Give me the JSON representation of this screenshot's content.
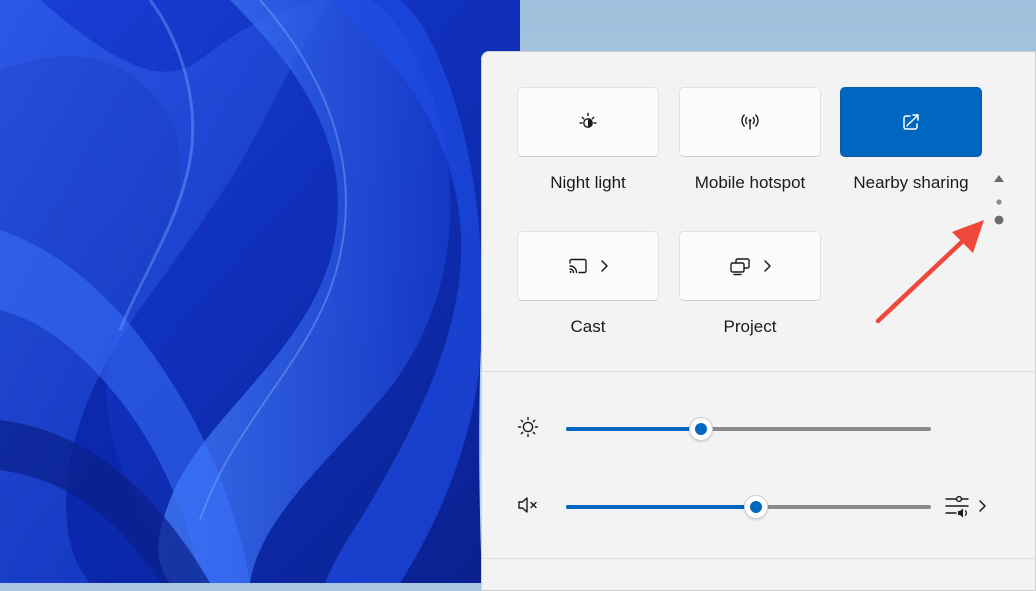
{
  "quick_settings": {
    "tiles": [
      {
        "label": "Night light",
        "icon": "night-light-icon",
        "active": false
      },
      {
        "label": "Mobile hotspot",
        "icon": "mobile-hotspot-icon",
        "active": false
      },
      {
        "label": "Nearby sharing",
        "icon": "nearby-sharing-icon",
        "active": true
      },
      {
        "label": "Cast",
        "icon": "cast-icon",
        "active": false,
        "has_submenu": true
      },
      {
        "label": "Project",
        "icon": "project-icon",
        "active": false,
        "has_submenu": true
      }
    ],
    "pager": {
      "pages": 2,
      "current_page": 2
    }
  },
  "sliders": {
    "brightness": {
      "icon": "brightness-icon",
      "level_fraction": 0.37
    },
    "volume": {
      "icon": "volume-muted-icon",
      "level_fraction": 0.52,
      "muted": true,
      "mixer_icon": "audio-mixer-icon"
    }
  },
  "colors": {
    "accent": "#0067c0",
    "panel_background": "#f3f3f3",
    "annotation_arrow": "#f0473b"
  }
}
